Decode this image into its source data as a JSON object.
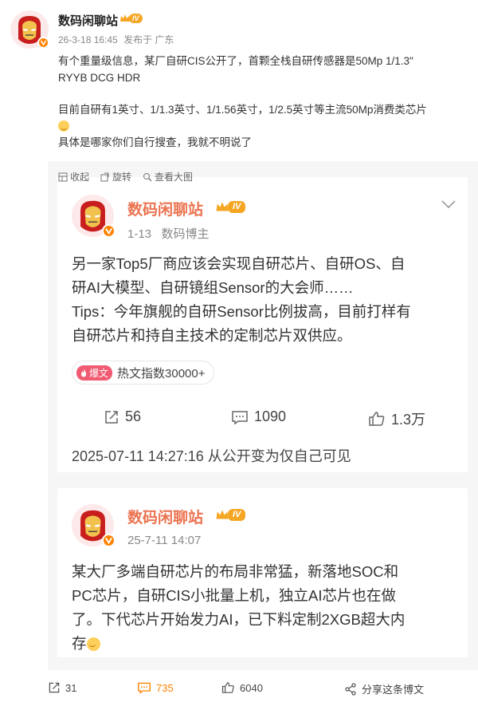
{
  "post": {
    "author": "数码闲聊站",
    "level_badge": "IV",
    "meta": {
      "time": "26-3-18 16:45",
      "source": "发布于 广东"
    },
    "text_lines": [
      "有个重量级信息，某厂自研CIS公开了，首颗全栈自研传感器是50Mp 1/1.3\"",
      "RYYB DCG HDR",
      "",
      "目前自研有1英寸、1/1.3英寸、1/1.56英寸，1/2.5英寸等主流50Mp消费类芯片",
      "具体是哪家你们自行搜查，我就不明说了"
    ],
    "actions": {
      "collapse": "收起",
      "rotate": "旋转",
      "view_large": "查看大图"
    }
  },
  "repost_card_1": {
    "author": "数码闲聊站",
    "level_badge": "IV",
    "date": "1-13",
    "role": "数码博主",
    "text_lines": [
      "另一家Top5厂商应该会实现自研芯片、自研OS、自",
      "研AI大模型、自研镜组Sensor的大会师……",
      "Tips：今年旗舰的自研Sensor比例拔高，目前打样有",
      "自研芯片和持自主技术的定制芯片双供应。"
    ],
    "hot_tag": {
      "pill": "爆文",
      "text": "热文指数30000+"
    },
    "stats": {
      "reposts": "56",
      "comments": "1090",
      "likes": "1.3万"
    },
    "visibility_note": "2025-07-11 14:27:16 从公开变为仅自己可见"
  },
  "repost_card_2": {
    "author": "数码闲聊站",
    "level_badge": "IV",
    "date": "25-7-11 14:07",
    "text_lines": [
      "某大厂多端自研芯片的布局非常猛，新落地SOC和",
      "PC芯片，自研CIS小批量上机，独立AI芯片也在做",
      "了。下代芯片开始发力AI，已下料定制2XGB超大内",
      "存"
    ]
  },
  "bottom_bar": {
    "reposts": "31",
    "comments": "735",
    "likes": "6040",
    "share": "分享这条博文"
  },
  "colors": {
    "accent_orange": "#ff8200",
    "name_orange": "#eb7350",
    "crown_gold": "#f5a623",
    "hot_pink": "#f05b72",
    "panel_bg": "#f6f6f6"
  },
  "icons": [
    "ironman-avatar",
    "verified-badge-icon",
    "crown-icon",
    "collapse-icon",
    "rotate-icon",
    "magnify-icon",
    "chevron-down-icon",
    "repost-icon",
    "comment-icon",
    "like-icon",
    "share-icon",
    "fire-icon",
    "smile-emoji-icon"
  ]
}
